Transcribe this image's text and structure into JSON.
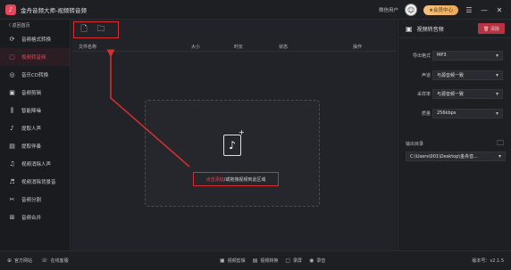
{
  "app": {
    "title": "金舟音频大师-视频转音频",
    "logo_char": "♪"
  },
  "titlebar": {
    "user_name": "微信用户",
    "vip_label": "★会员中心"
  },
  "sidebar": {
    "back_label": "〈 返回首页",
    "items": [
      {
        "label": "音频格式转换",
        "icon": "convert-icon",
        "glyph": "⟳",
        "active": false
      },
      {
        "label": "视频转音频",
        "icon": "video-audio-icon",
        "glyph": "▢",
        "active": true
      },
      {
        "label": "音乐CD转换",
        "icon": "cd-icon",
        "glyph": "◎",
        "active": false
      },
      {
        "label": "音频剪辑",
        "icon": "cut-icon",
        "glyph": "▣",
        "active": false
      },
      {
        "label": "智能降噪",
        "icon": "denoise-icon",
        "glyph": "⫼",
        "active": false
      },
      {
        "label": "提取人声",
        "icon": "vocal-icon",
        "glyph": "♪",
        "active": false
      },
      {
        "label": "提取伴奏",
        "icon": "accompaniment-icon",
        "glyph": "▤",
        "active": false
      },
      {
        "label": "视频消除人声",
        "icon": "remove-vocal-icon",
        "glyph": "♫",
        "active": false
      },
      {
        "label": "视频消除背景音",
        "icon": "remove-bg-icon",
        "glyph": "♬",
        "active": false
      },
      {
        "label": "音频分割",
        "icon": "split-icon",
        "glyph": "✂",
        "active": false
      },
      {
        "label": "音频合并",
        "icon": "merge-icon",
        "glyph": "⊞",
        "active": false
      }
    ]
  },
  "table": {
    "col_name": "文件名称",
    "col_size": "大小",
    "col_duration": "时长",
    "col_status": "状态",
    "col_action": "操作"
  },
  "dropzone": {
    "text_highlight": "点击添加",
    "text_rest": "/或拖拽视频到此区域"
  },
  "right_panel": {
    "title": "视频转音频",
    "delete_label": "🗑 清除",
    "fields": [
      {
        "label": "导出格式",
        "value": "MP3"
      },
      {
        "label": "声道",
        "value": "与源音频一致"
      },
      {
        "label": "采样率",
        "value": "与源音频一致"
      },
      {
        "label": "质量",
        "value": "256kbps"
      }
    ],
    "output_label": "输出目录",
    "output_path": "C:\\Users\\001\\Desktop\\金舟音..."
  },
  "statusbar": {
    "website": "官方网站",
    "support": "在线客服",
    "tools": [
      "视频剪辑",
      "视频转换",
      "录屏",
      "录音"
    ],
    "version": "版本号：v2.1.5"
  },
  "colors": {
    "accent": "#e8455a",
    "annotation": "#d72f2f",
    "bg": "#1b1c20"
  }
}
